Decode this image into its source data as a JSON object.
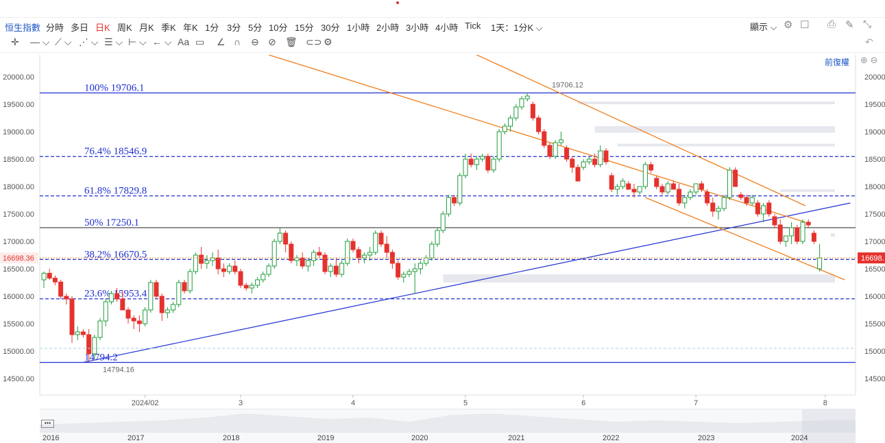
{
  "toolbar": {
    "index_label": "恒生指數",
    "periods": [
      "分時",
      "多日",
      "日K",
      "周K",
      "月K",
      "季K",
      "年K",
      "1分",
      "3分",
      "5分",
      "10分",
      "15分",
      "30分",
      "1小時",
      "2小時",
      "3小時",
      "4小時",
      "Tick",
      "1天：1分K"
    ],
    "active_period": "日K",
    "display_label": "顯示",
    "adjust_label": "前復權"
  },
  "colors": {
    "up": "#1e9b3a",
    "down": "#e5322d",
    "fib": "#1f2fd1",
    "channel": "#f07d1a",
    "trend": "#1f2fd1",
    "zone": "#e6e8ee"
  },
  "chart_data": {
    "type": "candlestick",
    "y_ticks": [
      "20000.00",
      "19500.00",
      "19000.00",
      "18500.00",
      "18000.00",
      "17500.00",
      "17000.00",
      "16500.00",
      "16000.00",
      "15500.00",
      "15000.00",
      "14500.00"
    ],
    "ylim": [
      14200,
      20150
    ],
    "x_ticks": [
      "2024/02",
      "3",
      "4",
      "5",
      "6",
      "7",
      "8"
    ],
    "current_price": "16698.36",
    "current_price_right": "16698.",
    "high_label": "19706.12",
    "low_label": "14794.16",
    "fib_levels": [
      {
        "label": "100% 19706.1",
        "value": 19706.1,
        "style": "solid"
      },
      {
        "label": "76.4% 18546.9",
        "value": 18546.9,
        "style": "dash"
      },
      {
        "label": "61.8% 17829.8",
        "value": 17829.8,
        "style": "dash"
      },
      {
        "label": "50% 17250.1",
        "value": 17250.1,
        "style": "solid-black"
      },
      {
        "label": "38.2% 16670.5",
        "value": 16670.5,
        "style": "dash"
      },
      {
        "label": "23.6% 15953.4",
        "value": 15953.4,
        "style": "dash"
      },
      {
        "label": "14794.2",
        "value": 14794.2,
        "style": "solid"
      }
    ],
    "candles": [
      [
        16300,
        16450,
        16150,
        16420
      ],
      [
        16420,
        16500,
        16300,
        16330
      ],
      [
        16330,
        16380,
        16200,
        16260
      ],
      [
        16260,
        16300,
        15950,
        16000
      ],
      [
        16000,
        16050,
        15850,
        15950
      ],
      [
        15950,
        16000,
        15150,
        15300
      ],
      [
        15300,
        15450,
        15200,
        15350
      ],
      [
        15350,
        15400,
        15250,
        15300
      ],
      [
        15300,
        15400,
        14800,
        14950
      ],
      [
        14950,
        15300,
        14850,
        15250
      ],
      [
        15250,
        15600,
        15200,
        15550
      ],
      [
        15550,
        15950,
        15450,
        15900
      ],
      [
        15900,
        16100,
        15850,
        16050
      ],
      [
        16050,
        16150,
        15900,
        15950
      ],
      [
        15950,
        16100,
        15800,
        15750
      ],
      [
        15750,
        15800,
        15500,
        15600
      ],
      [
        15600,
        15650,
        15400,
        15550
      ],
      [
        15550,
        15650,
        15350,
        15500
      ],
      [
        15500,
        15800,
        15450,
        15750
      ],
      [
        15750,
        16300,
        15700,
        16250
      ],
      [
        16250,
        16300,
        15950,
        16000
      ],
      [
        16000,
        16050,
        15550,
        15700
      ],
      [
        15700,
        15800,
        15600,
        15750
      ],
      [
        15750,
        15900,
        15700,
        15850
      ],
      [
        15850,
        16300,
        15800,
        16250
      ],
      [
        16250,
        16300,
        16050,
        16100
      ],
      [
        16100,
        16500,
        16050,
        16450
      ],
      [
        16450,
        16800,
        16400,
        16750
      ],
      [
        16750,
        16900,
        16500,
        16600
      ],
      [
        16600,
        16750,
        16500,
        16650
      ],
      [
        16650,
        16800,
        16550,
        16700
      ],
      [
        16700,
        16850,
        16400,
        16500
      ],
      [
        16500,
        16600,
        16350,
        16450
      ],
      [
        16450,
        16600,
        16400,
        16550
      ],
      [
        16550,
        16650,
        16400,
        16450
      ],
      [
        16450,
        16500,
        16150,
        16200
      ],
      [
        16200,
        16250,
        16100,
        16150
      ],
      [
        16150,
        16250,
        16050,
        16200
      ],
      [
        16200,
        16350,
        16150,
        16300
      ],
      [
        16300,
        16450,
        16250,
        16400
      ],
      [
        16400,
        16600,
        16350,
        16550
      ],
      [
        16550,
        17050,
        16500,
        17000
      ],
      [
        17000,
        17250,
        16950,
        17150
      ],
      [
        17150,
        17200,
        16800,
        16950
      ],
      [
        16950,
        17000,
        16600,
        16650
      ],
      [
        16650,
        16750,
        16550,
        16700
      ],
      [
        16700,
        16800,
        16500,
        16550
      ],
      [
        16550,
        16700,
        16450,
        16650
      ],
      [
        16650,
        16850,
        16550,
        16800
      ],
      [
        16800,
        16900,
        16700,
        16750
      ],
      [
        16750,
        16800,
        16400,
        16450
      ],
      [
        16450,
        16600,
        16350,
        16550
      ],
      [
        16550,
        16700,
        16350,
        16400
      ],
      [
        16400,
        16650,
        16350,
        16600
      ],
      [
        16600,
        17050,
        16550,
        17000
      ],
      [
        17000,
        17050,
        16800,
        16850
      ],
      [
        16850,
        16900,
        16600,
        16700
      ],
      [
        16700,
        16800,
        16600,
        16750
      ],
      [
        16750,
        16900,
        16650,
        16800
      ],
      [
        16800,
        17200,
        16750,
        17150
      ],
      [
        17150,
        17200,
        16900,
        16950
      ],
      [
        16950,
        17100,
        16700,
        16800
      ],
      [
        16800,
        16850,
        16500,
        16600
      ],
      [
        16600,
        16650,
        16300,
        16350
      ],
      [
        16350,
        16450,
        16250,
        16400
      ],
      [
        16400,
        16500,
        16350,
        16450
      ],
      [
        16450,
        16600,
        16050,
        16500
      ],
      [
        16500,
        16650,
        16400,
        16600
      ],
      [
        16600,
        16750,
        16550,
        16700
      ],
      [
        16700,
        17000,
        16650,
        16950
      ],
      [
        16950,
        17250,
        16900,
        17200
      ],
      [
        17200,
        17550,
        17150,
        17500
      ],
      [
        17500,
        17850,
        17450,
        17800
      ],
      [
        17800,
        17850,
        17650,
        17700
      ],
      [
        17700,
        18250,
        17650,
        18200
      ],
      [
        18200,
        18600,
        18150,
        18500
      ],
      [
        18500,
        18600,
        18350,
        18400
      ],
      [
        18400,
        18550,
        18300,
        18500
      ],
      [
        18500,
        18600,
        18450,
        18550
      ],
      [
        18550,
        18600,
        18250,
        18300
      ],
      [
        18300,
        18550,
        18250,
        18500
      ],
      [
        18500,
        19050,
        18450,
        19000
      ],
      [
        19000,
        19150,
        18950,
        19100
      ],
      [
        19100,
        19300,
        19000,
        19250
      ],
      [
        19250,
        19500,
        19200,
        19450
      ],
      [
        19450,
        19650,
        19400,
        19600
      ],
      [
        19600,
        19710,
        19550,
        19650
      ],
      [
        19500,
        19550,
        19200,
        19250
      ],
      [
        19250,
        19300,
        18950,
        19000
      ],
      [
        19000,
        19050,
        18700,
        18750
      ],
      [
        18750,
        18800,
        18500,
        18550
      ],
      [
        18550,
        18850,
        18500,
        18800
      ],
      [
        18800,
        19000,
        18750,
        18850
      ],
      [
        18700,
        18750,
        18450,
        18500
      ],
      [
        18500,
        18550,
        18250,
        18350
      ],
      [
        18350,
        18400,
        18100,
        18100
      ],
      [
        18350,
        18500,
        18300,
        18450
      ],
      [
        18450,
        18550,
        18400,
        18500
      ],
      [
        18500,
        18600,
        18350,
        18400
      ],
      [
        18400,
        18750,
        18350,
        18650
      ],
      [
        18650,
        18700,
        18400,
        18450
      ],
      [
        18200,
        18250,
        17900,
        17950
      ],
      [
        17950,
        18050,
        17850,
        18000
      ],
      [
        18000,
        18150,
        17950,
        18100
      ],
      [
        18050,
        18100,
        17950,
        17950
      ],
      [
        17950,
        18050,
        17800,
        17900
      ],
      [
        17900,
        18000,
        17850,
        18000
      ],
      [
        18000,
        18450,
        17950,
        18400
      ],
      [
        18400,
        18450,
        18250,
        18300
      ],
      [
        18150,
        18200,
        17950,
        18000
      ],
      [
        18000,
        18050,
        17850,
        17900
      ],
      [
        17900,
        18100,
        17850,
        18050
      ],
      [
        18050,
        18100,
        17950,
        17950
      ],
      [
        17950,
        18050,
        17650,
        17700
      ],
      [
        17700,
        17850,
        17600,
        17800
      ],
      [
        17800,
        17950,
        17750,
        17900
      ],
      [
        17900,
        18050,
        17850,
        18050
      ],
      [
        18050,
        18100,
        17900,
        17950
      ],
      [
        17900,
        17950,
        17650,
        17700
      ],
      [
        17700,
        17800,
        17450,
        17550
      ],
      [
        17550,
        17650,
        17400,
        17600
      ],
      [
        17600,
        17850,
        17550,
        17800
      ],
      [
        17800,
        18350,
        17750,
        18300
      ],
      [
        18300,
        18350,
        18050,
        18000
      ],
      [
        17850,
        17900,
        17750,
        17800
      ],
      [
        17800,
        17850,
        17650,
        17700
      ],
      [
        17700,
        17850,
        17650,
        17800
      ],
      [
        17700,
        17750,
        17450,
        17500
      ],
      [
        17500,
        17700,
        17350,
        17650
      ],
      [
        17700,
        17750,
        17450,
        17500
      ],
      [
        17450,
        17500,
        17250,
        17300
      ],
      [
        17300,
        17400,
        16950,
        17000
      ],
      [
        17000,
        17100,
        16900,
        17100
      ],
      [
        17100,
        17350,
        16950,
        17250
      ],
      [
        17250,
        17300,
        16950,
        17000
      ],
      [
        17000,
        17400,
        16950,
        17350
      ],
      [
        17350,
        17400,
        17250,
        17300
      ],
      [
        17150,
        17200,
        16950,
        17000
      ],
      [
        16500,
        16950,
        16450,
        16698.36
      ]
    ],
    "resistance_zones": [
      {
        "from": 19550,
        "to": 19500,
        "start": 95
      },
      {
        "from": 19100,
        "to": 18980,
        "start": 98
      },
      {
        "from": 18780,
        "to": 18730,
        "start": 102
      },
      {
        "from": 17950,
        "to": 17920,
        "start": 131
      },
      {
        "from": 16400,
        "to": 16250,
        "start": 71
      },
      {
        "from": 17150,
        "to": 17080,
        "start": 140
      }
    ],
    "channel_lines": [
      {
        "from": [
          40,
          20400
        ],
        "to": [
          134,
          17350
        ]
      },
      {
        "from": [
          77,
          20400
        ],
        "to": [
          134,
          17650
        ]
      },
      {
        "from": [
          107,
          17800
        ],
        "to": [
          141,
          16300
        ]
      }
    ],
    "trend_line": {
      "from": [
        7,
        14794
      ],
      "to": [
        142,
        17700
      ]
    }
  },
  "navigator": {
    "years": [
      "2016",
      "2017",
      "2018",
      "2019",
      "2020",
      "2021",
      "2022",
      "2023",
      "2024"
    ]
  }
}
